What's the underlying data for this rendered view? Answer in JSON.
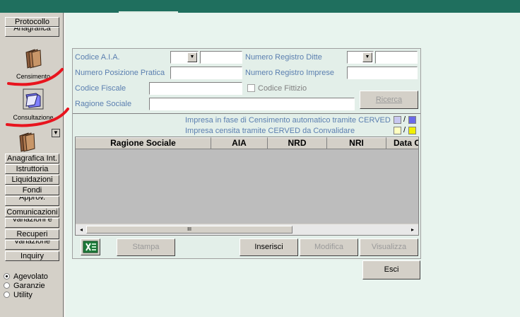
{
  "colors": {
    "titlebar": "#1f6f5e",
    "label_blue": "#5b7fb0",
    "annotation_red": "#e8141e",
    "legend_lilac": "#c8c8f0",
    "legend_blue": "#6a6ae8",
    "legend_cream": "#ffffc0",
    "legend_yellow": "#f0f000"
  },
  "sidebar": {
    "top_buttons": [
      "Protocollo",
      "Anagrafica"
    ],
    "icon_buttons": [
      {
        "label": "Censimento",
        "icon": "folder-icon"
      },
      {
        "label": "Consultazione",
        "icon": "open-folder-icon"
      },
      {
        "label": "",
        "icon": "folder-icon"
      }
    ],
    "menu": [
      "Anagrafica Int.",
      "Istruttoria",
      "Liquidazioni",
      "Fondi",
      "Approv.",
      "Comunicazioni",
      "Variazioni e",
      "Recuperi",
      "Variazione",
      "Inquiry"
    ],
    "radios": [
      {
        "label": "Agevolato",
        "checked": true
      },
      {
        "label": "Garanzie",
        "checked": false
      },
      {
        "label": "Utility",
        "checked": false
      }
    ]
  },
  "form": {
    "codice_aia": "Codice A.I.A.",
    "numero_posizione": "Numero Posizione Pratica",
    "codice_fiscale": "Codice Fiscale",
    "ragione_sociale": "Ragione Sociale",
    "numero_registro_ditte": "Numero Registro Ditte",
    "numero_registro_imprese": "Numero Registro Imprese",
    "codice_fittizio": "Codice Fittizio",
    "ricerca_button": "Ricerca",
    "legend_1": "Impresa in fase di Censimento automatico tramite CERVED",
    "legend_2": "Impresa censita tramite CERVED da Convalidare",
    "legend_sep": "/"
  },
  "grid": {
    "columns": [
      "Ragione Sociale",
      "AIA",
      "NRD",
      "NRI",
      "Data C"
    ],
    "scroll_grip": "III"
  },
  "actions": {
    "stampa": "Stampa",
    "inserisci": "Inserisci",
    "modifica": "Modifica",
    "visualizza": "Visualizza",
    "esci": "Esci",
    "excel_icon": "excel-icon"
  }
}
